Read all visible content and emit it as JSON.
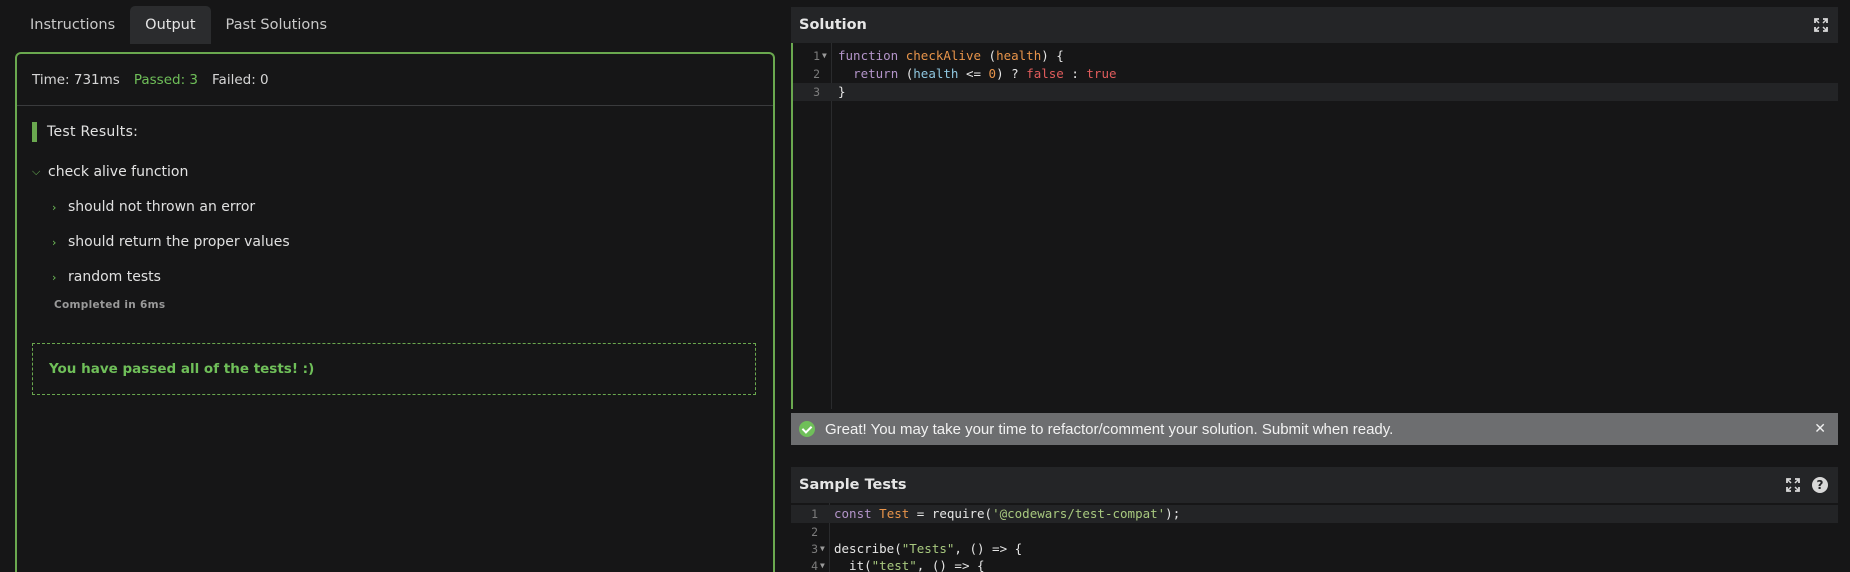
{
  "tabs": [
    "Instructions",
    "Output",
    "Past Solutions"
  ],
  "active_tab": "Output",
  "stats": {
    "time": "Time: 731ms",
    "passed": "Passed: 3",
    "failed": "Failed: 0"
  },
  "results": {
    "heading": "Test Results:",
    "describe": "check alive function",
    "tests": [
      "should not thrown an error",
      "should return the proper values",
      "random tests"
    ],
    "completed": "Completed in 6ms",
    "pass_message": "You have passed all of the tests! :)"
  },
  "solution": {
    "title": "Solution",
    "lines": [
      "1",
      "2",
      "3"
    ]
  },
  "notification": "Great! You may take your time to refactor/comment your solution. Submit when ready.",
  "sample_tests": {
    "title": "Sample Tests",
    "lines": [
      "1",
      "2",
      "3",
      "4"
    ],
    "help": "?"
  },
  "colors": {
    "accent": "#6aa84f",
    "passed": "#6fbf59"
  }
}
